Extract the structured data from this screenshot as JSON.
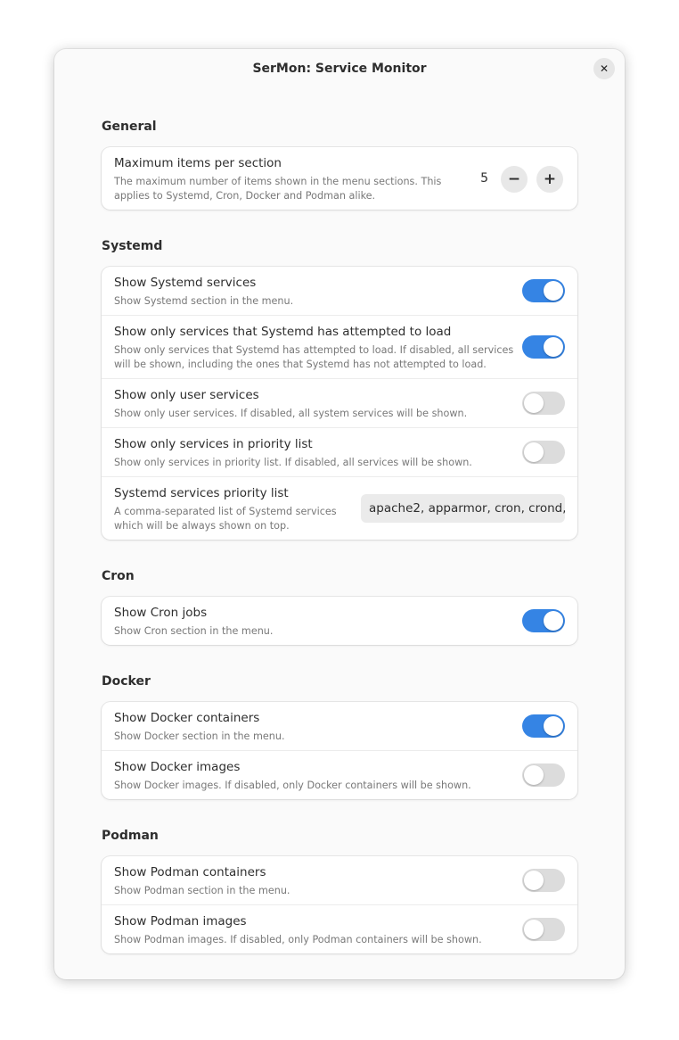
{
  "window": {
    "title": "SerMon: Service Monitor"
  },
  "general": {
    "title": "General",
    "max_items": {
      "label": "Maximum items per section",
      "description": "The maximum number of items shown in the menu sections. This applies to Systemd, Cron, Docker and Podman alike.",
      "value": "5",
      "decrement": "−",
      "increment": "+"
    }
  },
  "systemd": {
    "title": "Systemd",
    "rows": [
      {
        "label": "Show Systemd services",
        "description": "Show Systemd section in the menu.",
        "enabled": true
      },
      {
        "label": "Show only services that Systemd has attempted to load",
        "description": "Show only services that Systemd has attempted to load. If disabled, all services will be shown, including the ones that Systemd has not attempted to load.",
        "enabled": true
      },
      {
        "label": "Show only user services",
        "description": "Show only user services. If disabled, all system services will be shown.",
        "enabled": false
      },
      {
        "label": "Show only services in priority list",
        "description": "Show only services in priority list. If disabled, all services will be shown.",
        "enabled": false
      }
    ],
    "priority": {
      "label": "Systemd services priority list",
      "description": "A comma-separated list of Systemd services which will be always shown on top.",
      "value": "apache2, apparmor, cron, crond,"
    }
  },
  "cron": {
    "title": "Cron",
    "rows": [
      {
        "label": "Show Cron jobs",
        "description": "Show Cron section in the menu.",
        "enabled": true
      }
    ]
  },
  "docker": {
    "title": "Docker",
    "rows": [
      {
        "label": "Show Docker containers",
        "description": "Show Docker section in the menu.",
        "enabled": true
      },
      {
        "label": "Show Docker images",
        "description": "Show Docker images. If disabled, only Docker containers will be shown.",
        "enabled": false
      }
    ]
  },
  "podman": {
    "title": "Podman",
    "rows": [
      {
        "label": "Show Podman containers",
        "description": "Show Podman section in the menu.",
        "enabled": false
      },
      {
        "label": "Show Podman images",
        "description": "Show Podman images. If disabled, only Podman containers will be shown.",
        "enabled": false
      }
    ]
  },
  "colors": {
    "accent": "#3584e4",
    "switch_off": "#dcdcdc"
  }
}
